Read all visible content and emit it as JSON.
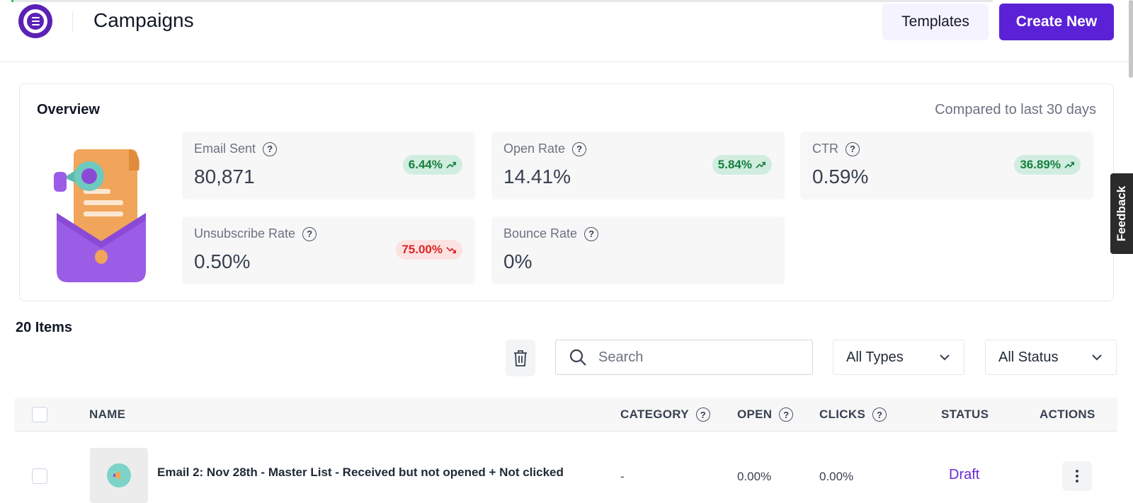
{
  "header": {
    "title": "Campaigns",
    "templates_label": "Templates",
    "create_label": "Create New"
  },
  "overview": {
    "title": "Overview",
    "compare_text": "Compared to last 30 days",
    "metrics": [
      {
        "label": "Email Sent",
        "value": "80,871",
        "change": "6.44%",
        "trend": "up"
      },
      {
        "label": "Open Rate",
        "value": "14.41%",
        "change": "5.84%",
        "trend": "up"
      },
      {
        "label": "CTR",
        "value": "0.59%",
        "change": "36.89%",
        "trend": "up"
      },
      {
        "label": "Unsubscribe Rate",
        "value": "0.50%",
        "change": "75.00%",
        "trend": "down"
      },
      {
        "label": "Bounce Rate",
        "value": "0%"
      }
    ]
  },
  "feedback_label": "Feedback",
  "list": {
    "count_label": "20 Items",
    "search_placeholder": "Search",
    "type_filter": "All Types",
    "status_filter": "All Status",
    "columns": {
      "name": "NAME",
      "category": "CATEGORY",
      "open": "OPEN",
      "clicks": "CLICKS",
      "status": "STATUS",
      "actions": "ACTIONS"
    },
    "rows": [
      {
        "name": "Email 2: Nov 28th - Master List - Received but not opened + Not clicked",
        "category": "-",
        "open": "0.00%",
        "clicks": "0.00%",
        "status": "Draft"
      }
    ]
  },
  "colors": {
    "accent": "#5b21d6",
    "positive": "#15803d",
    "negative": "#dc2626",
    "draft": "#6d28d9"
  }
}
